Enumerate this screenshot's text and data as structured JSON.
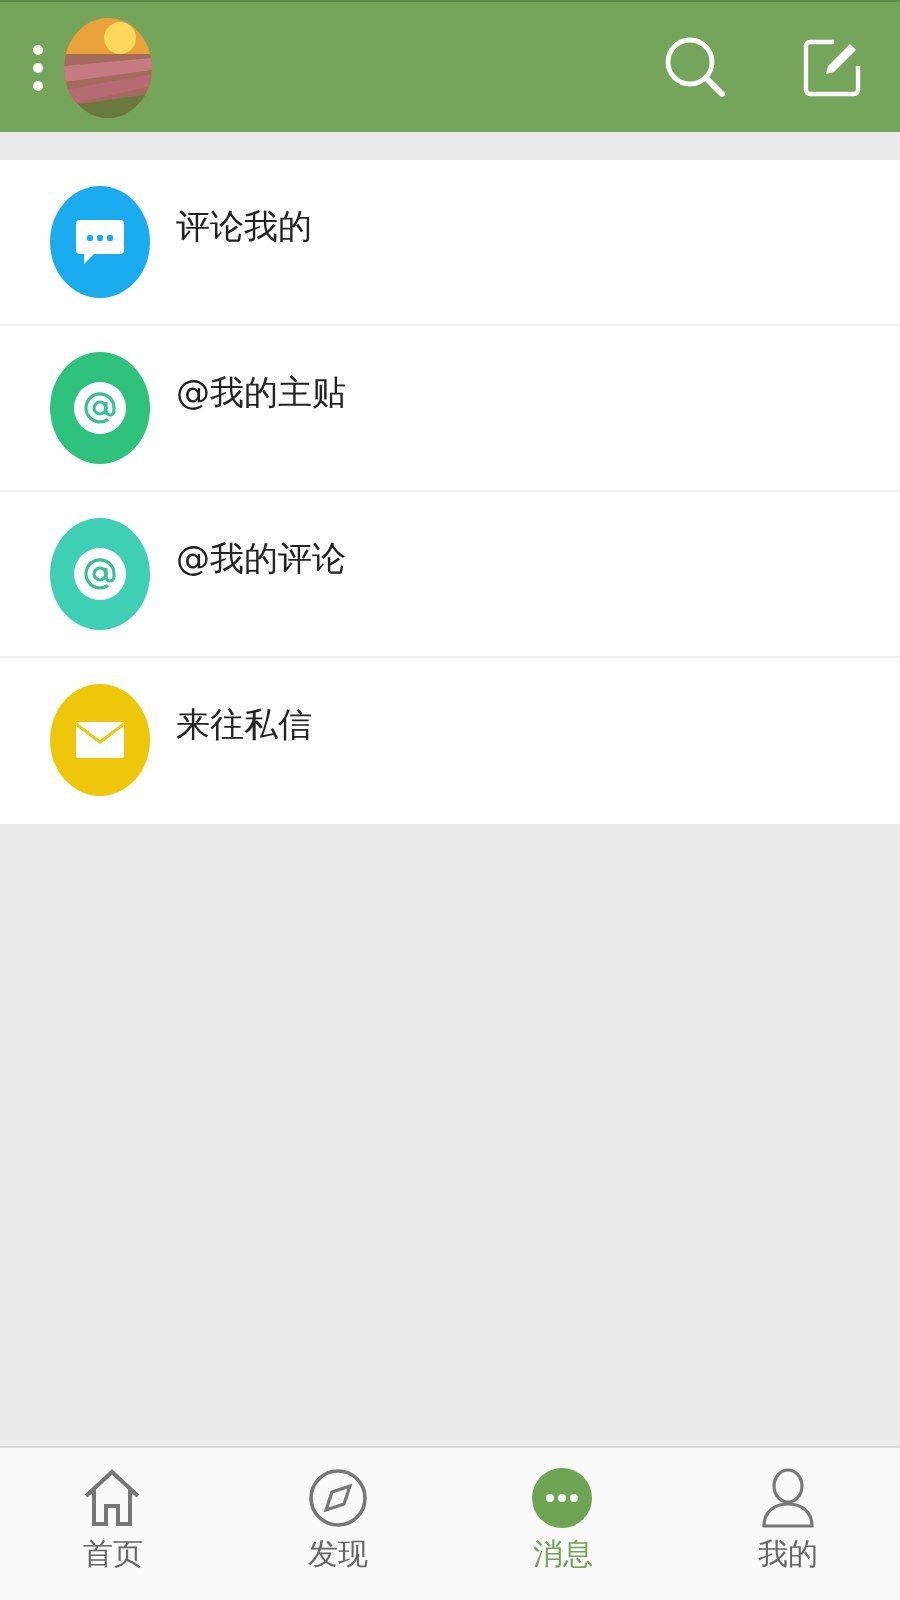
{
  "items": [
    {
      "label": "评论我的",
      "kind": "comment",
      "color": "#1aaaee"
    },
    {
      "label": "@我的主贴",
      "kind": "at",
      "color": "#2ec27e"
    },
    {
      "label": "@我的评论",
      "kind": "at",
      "color": "#3ecfb5"
    },
    {
      "label": "来往私信",
      "kind": "mail",
      "color": "#eec70a"
    }
  ],
  "tabs": [
    {
      "label": "首页",
      "kind": "home",
      "selected": false
    },
    {
      "label": "发现",
      "kind": "compass",
      "selected": false
    },
    {
      "label": "消息",
      "kind": "chat",
      "selected": true
    },
    {
      "label": "我的",
      "kind": "person",
      "selected": false
    }
  ]
}
